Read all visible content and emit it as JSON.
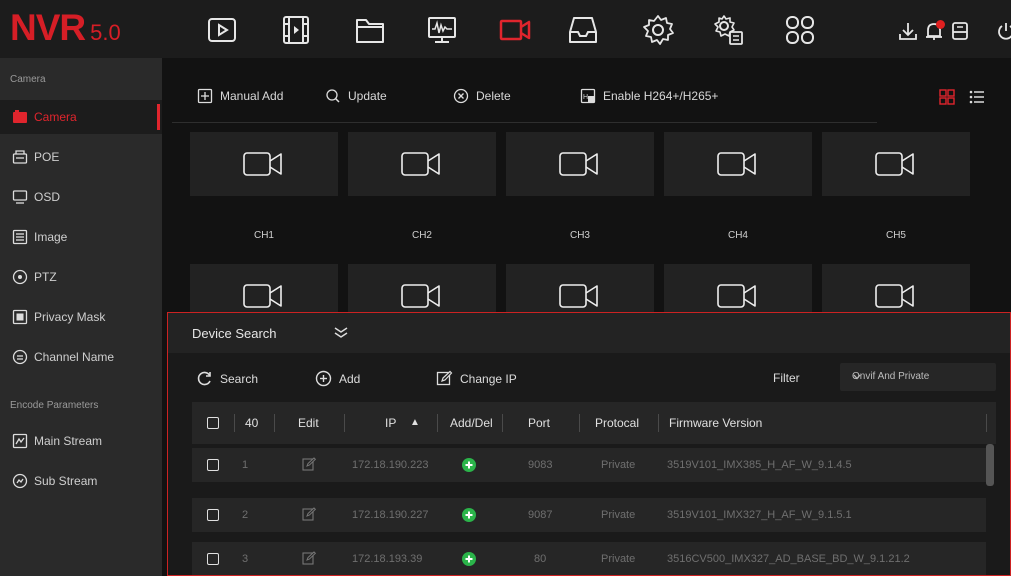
{
  "app": {
    "logo_main": "NVR",
    "logo_version": "5.0"
  },
  "top_icons": [
    "playback-icon",
    "video-file-icon",
    "folder-icon",
    "system-info-icon",
    "camera-icon",
    "storage-icon",
    "settings-icon",
    "network-settings-icon",
    "apps-icon"
  ],
  "sys_icons": [
    "download-icon",
    "alarm-notification-icon",
    "record-status-icon",
    "power-icon"
  ],
  "colors": {
    "accent": "#e0252d",
    "add_green": "#2bb44a",
    "sidebar_bg": "#2a2a2a"
  },
  "sidebar": {
    "section_camera": "Camera",
    "items": [
      {
        "label": "Camera",
        "icon": "camera-icon"
      },
      {
        "label": "POE",
        "icon": "poe-icon"
      },
      {
        "label": "OSD",
        "icon": "monitor-icon"
      },
      {
        "label": "Image",
        "icon": "image-settings-icon"
      },
      {
        "label": "PTZ",
        "icon": "ptz-icon"
      },
      {
        "label": "Privacy Mask",
        "icon": "privacy-mask-icon"
      },
      {
        "label": "Channel Name",
        "icon": "channel-name-icon"
      }
    ],
    "section_encode": "Encode Parameters",
    "encode_items": [
      {
        "label": "Main Stream",
        "icon": "main-stream-icon"
      },
      {
        "label": "Sub Stream",
        "icon": "sub-stream-icon"
      }
    ]
  },
  "toolbar": {
    "manual_add": "Manual Add",
    "update": "Update",
    "delete": "Delete",
    "enable_h264": "Enable H264+/H265+"
  },
  "channels": [
    "CH1",
    "CH2",
    "CH3",
    "CH4",
    "CH5"
  ],
  "device_search": {
    "title": "Device Search",
    "search": "Search",
    "add": "Add",
    "change_ip": "Change IP",
    "filter_label": "Filter",
    "filter_value": "Onvif And Private",
    "columns": {
      "count": "40",
      "edit": "Edit",
      "ip": "IP",
      "sort_arrow": "▲",
      "add_del": "Add/Del",
      "port": "Port",
      "protocol": "Protocal",
      "firmware": "Firmware Version"
    },
    "rows": [
      {
        "index": "1",
        "ip": "172.18.190.223",
        "port": "9083",
        "protocol": "Private",
        "firmware": "3519V101_IMX385_H_AF_W_9.1.4.5"
      },
      {
        "index": "2",
        "ip": "172.18.190.227",
        "port": "9087",
        "protocol": "Private",
        "firmware": "3519V101_IMX327_H_AF_W_9.1.5.1"
      },
      {
        "index": "3",
        "ip": "172.18.193.39",
        "port": "80",
        "protocol": "Private",
        "firmware": "3516CV500_IMX327_AD_BASE_BD_W_9.1.21.2"
      }
    ]
  }
}
